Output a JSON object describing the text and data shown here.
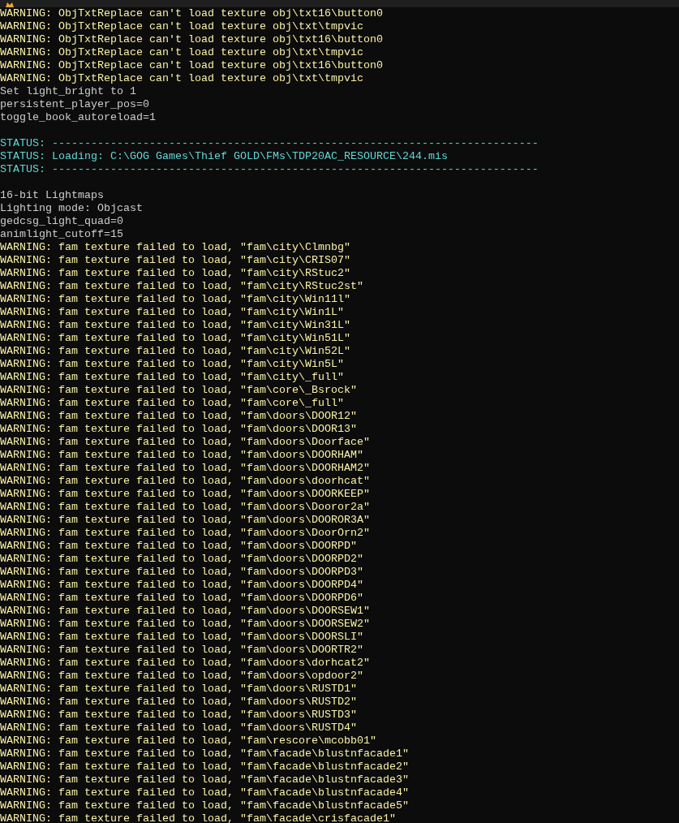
{
  "console_lines": [
    {
      "kind": "warning",
      "text": "WARNING: ObjTxtReplace can't load texture obj\\txt16\\button0"
    },
    {
      "kind": "warning",
      "text": "WARNING: ObjTxtReplace can't load texture obj\\txt\\tmpvic"
    },
    {
      "kind": "warning",
      "text": "WARNING: ObjTxtReplace can't load texture obj\\txt16\\button0"
    },
    {
      "kind": "warning",
      "text": "WARNING: ObjTxtReplace can't load texture obj\\txt\\tmpvic"
    },
    {
      "kind": "warning",
      "text": "WARNING: ObjTxtReplace can't load texture obj\\txt16\\button0"
    },
    {
      "kind": "warning",
      "text": "WARNING: ObjTxtReplace can't load texture obj\\txt\\tmpvic"
    },
    {
      "kind": "info",
      "text": "Set light_bright to 1"
    },
    {
      "kind": "info",
      "text": "persistent_player_pos=0"
    },
    {
      "kind": "info",
      "text": "toggle_book_autoreload=1"
    },
    {
      "kind": "blank"
    },
    {
      "kind": "status",
      "text": "STATUS: ---------------------------------------------------------------------------"
    },
    {
      "kind": "status",
      "text": "STATUS: Loading: C:\\GOG Games\\Thief GOLD\\FMs\\TDP20AC_RESOURCE\\244.mis"
    },
    {
      "kind": "status",
      "text": "STATUS: ---------------------------------------------------------------------------"
    },
    {
      "kind": "blank"
    },
    {
      "kind": "info",
      "text": "16-bit Lightmaps"
    },
    {
      "kind": "info",
      "text": "Lighting mode: Objcast"
    },
    {
      "kind": "info",
      "text": "gedcsg_light_quad=0"
    },
    {
      "kind": "info",
      "text": "animlight_cutoff=15"
    },
    {
      "kind": "warning",
      "text": "WARNING: fam texture failed to load, \"fam\\city\\Clmnbg\""
    },
    {
      "kind": "warning",
      "text": "WARNING: fam texture failed to load, \"fam\\city\\CRIS07\""
    },
    {
      "kind": "warning",
      "text": "WARNING: fam texture failed to load, \"fam\\city\\RStuc2\""
    },
    {
      "kind": "warning",
      "text": "WARNING: fam texture failed to load, \"fam\\city\\RStuc2st\""
    },
    {
      "kind": "warning",
      "text": "WARNING: fam texture failed to load, \"fam\\city\\Win11l\""
    },
    {
      "kind": "warning",
      "text": "WARNING: fam texture failed to load, \"fam\\city\\Win1L\""
    },
    {
      "kind": "warning",
      "text": "WARNING: fam texture failed to load, \"fam\\city\\Win31L\""
    },
    {
      "kind": "warning",
      "text": "WARNING: fam texture failed to load, \"fam\\city\\Win51L\""
    },
    {
      "kind": "warning",
      "text": "WARNING: fam texture failed to load, \"fam\\city\\Win52L\""
    },
    {
      "kind": "warning",
      "text": "WARNING: fam texture failed to load, \"fam\\city\\Win5L\""
    },
    {
      "kind": "warning",
      "text": "WARNING: fam texture failed to load, \"fam\\city\\_full\""
    },
    {
      "kind": "warning",
      "text": "WARNING: fam texture failed to load, \"fam\\core\\_Bsrock\""
    },
    {
      "kind": "warning",
      "text": "WARNING: fam texture failed to load, \"fam\\core\\_full\""
    },
    {
      "kind": "warning",
      "text": "WARNING: fam texture failed to load, \"fam\\doors\\DOOR12\""
    },
    {
      "kind": "warning",
      "text": "WARNING: fam texture failed to load, \"fam\\doors\\DOOR13\""
    },
    {
      "kind": "warning",
      "text": "WARNING: fam texture failed to load, \"fam\\doors\\Doorface\""
    },
    {
      "kind": "warning",
      "text": "WARNING: fam texture failed to load, \"fam\\doors\\DOORHAM\""
    },
    {
      "kind": "warning",
      "text": "WARNING: fam texture failed to load, \"fam\\doors\\DOORHAM2\""
    },
    {
      "kind": "warning",
      "text": "WARNING: fam texture failed to load, \"fam\\doors\\doorhcat\""
    },
    {
      "kind": "warning",
      "text": "WARNING: fam texture failed to load, \"fam\\doors\\DOORKEEP\""
    },
    {
      "kind": "warning",
      "text": "WARNING: fam texture failed to load, \"fam\\doors\\Dooror2a\""
    },
    {
      "kind": "warning",
      "text": "WARNING: fam texture failed to load, \"fam\\doors\\DOOROR3A\""
    },
    {
      "kind": "warning",
      "text": "WARNING: fam texture failed to load, \"fam\\doors\\DoorOrn2\""
    },
    {
      "kind": "warning",
      "text": "WARNING: fam texture failed to load, \"fam\\doors\\DOORPD\""
    },
    {
      "kind": "warning",
      "text": "WARNING: fam texture failed to load, \"fam\\doors\\DOORPD2\""
    },
    {
      "kind": "warning",
      "text": "WARNING: fam texture failed to load, \"fam\\doors\\DOORPD3\""
    },
    {
      "kind": "warning",
      "text": "WARNING: fam texture failed to load, \"fam\\doors\\DOORPD4\""
    },
    {
      "kind": "warning",
      "text": "WARNING: fam texture failed to load, \"fam\\doors\\DOORPD6\""
    },
    {
      "kind": "warning",
      "text": "WARNING: fam texture failed to load, \"fam\\doors\\DOORSEW1\""
    },
    {
      "kind": "warning",
      "text": "WARNING: fam texture failed to load, \"fam\\doors\\DOORSEW2\""
    },
    {
      "kind": "warning",
      "text": "WARNING: fam texture failed to load, \"fam\\doors\\DOORSLI\""
    },
    {
      "kind": "warning",
      "text": "WARNING: fam texture failed to load, \"fam\\doors\\DOORTR2\""
    },
    {
      "kind": "warning",
      "text": "WARNING: fam texture failed to load, \"fam\\doors\\dorhcat2\""
    },
    {
      "kind": "warning",
      "text": "WARNING: fam texture failed to load, \"fam\\doors\\opdoor2\""
    },
    {
      "kind": "warning",
      "text": "WARNING: fam texture failed to load, \"fam\\doors\\RUSTD1\""
    },
    {
      "kind": "warning",
      "text": "WARNING: fam texture failed to load, \"fam\\doors\\RUSTD2\""
    },
    {
      "kind": "warning",
      "text": "WARNING: fam texture failed to load, \"fam\\doors\\RUSTD3\""
    },
    {
      "kind": "warning",
      "text": "WARNING: fam texture failed to load, \"fam\\doors\\RUSTD4\""
    },
    {
      "kind": "warning",
      "text": "WARNING: fam texture failed to load, \"fam\\rescore\\mcobb01\""
    },
    {
      "kind": "warning",
      "text": "WARNING: fam texture failed to load, \"fam\\facade\\blustnfacade1\""
    },
    {
      "kind": "warning",
      "text": "WARNING: fam texture failed to load, \"fam\\facade\\blustnfacade2\""
    },
    {
      "kind": "warning",
      "text": "WARNING: fam texture failed to load, \"fam\\facade\\blustnfacade3\""
    },
    {
      "kind": "warning",
      "text": "WARNING: fam texture failed to load, \"fam\\facade\\blustnfacade4\""
    },
    {
      "kind": "warning",
      "text": "WARNING: fam texture failed to load, \"fam\\facade\\blustnfacade5\""
    },
    {
      "kind": "warning",
      "text": "WARNING: fam texture failed to load, \"fam\\facade\\crisfacade1\""
    }
  ]
}
